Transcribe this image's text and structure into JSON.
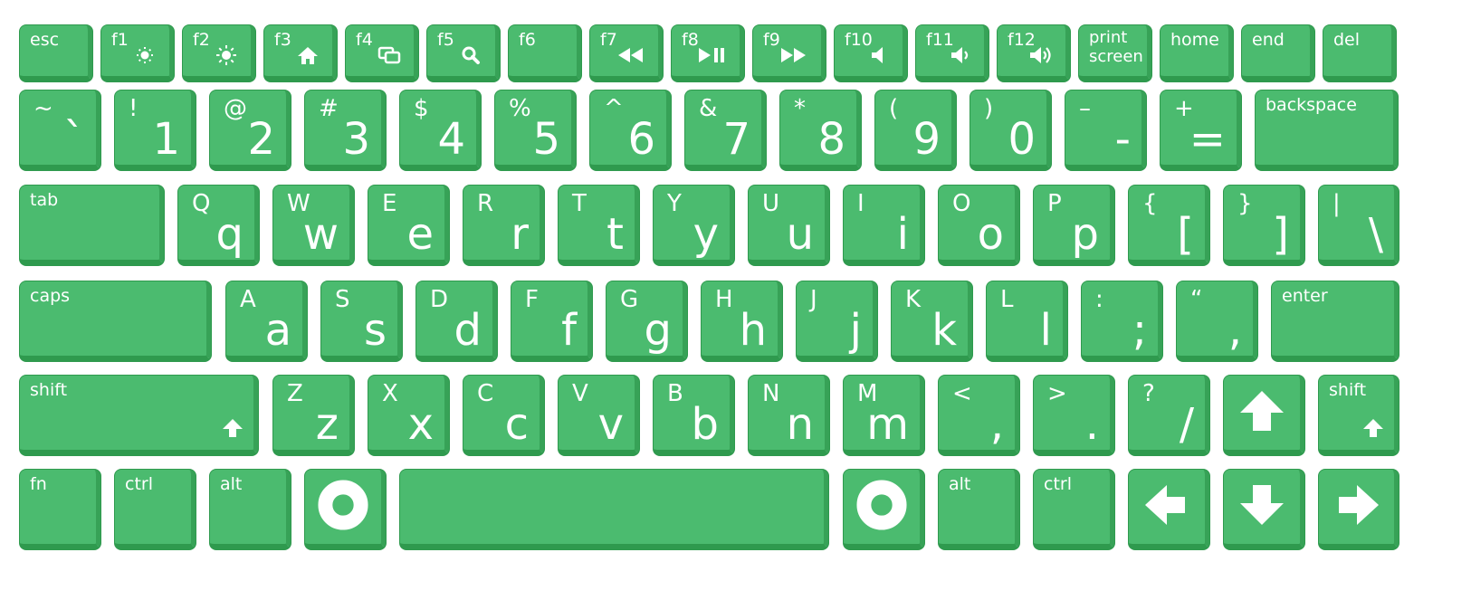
{
  "colors": {
    "key": "#4bbb6f",
    "key_edge": "#2f9a4e",
    "legend": "#ffffff",
    "background": "#ffffff"
  },
  "rows": [
    [
      {
        "id": "esc",
        "label": "esc"
      },
      {
        "id": "f1",
        "label": "f1",
        "icon": "brightness-down-icon"
      },
      {
        "id": "f2",
        "label": "f2",
        "icon": "brightness-up-icon"
      },
      {
        "id": "f3",
        "label": "f3",
        "icon": "home-icon"
      },
      {
        "id": "f4",
        "label": "f4",
        "icon": "window-switch-icon"
      },
      {
        "id": "f5",
        "label": "f5",
        "icon": "search-icon"
      },
      {
        "id": "f6",
        "label": "f6"
      },
      {
        "id": "f7",
        "label": "f7",
        "icon": "rewind-icon"
      },
      {
        "id": "f8",
        "label": "f8",
        "icon": "play-pause-icon"
      },
      {
        "id": "f9",
        "label": "f9",
        "icon": "fast-forward-icon"
      },
      {
        "id": "f10",
        "label": "f10",
        "icon": "mute-icon"
      },
      {
        "id": "f11",
        "label": "f11",
        "icon": "volume-down-icon"
      },
      {
        "id": "f12",
        "label": "f12",
        "icon": "volume-up-icon"
      },
      {
        "id": "print-screen",
        "label": "print\nscreen"
      },
      {
        "id": "home",
        "label": "home"
      },
      {
        "id": "end",
        "label": "end"
      },
      {
        "id": "del",
        "label": "del"
      }
    ],
    [
      {
        "id": "backtick",
        "top": "~",
        "main": "`"
      },
      {
        "id": "1",
        "top": "!",
        "main": "1"
      },
      {
        "id": "2",
        "top": "@",
        "main": "2"
      },
      {
        "id": "3",
        "top": "#",
        "main": "3"
      },
      {
        "id": "4",
        "top": "$",
        "main": "4"
      },
      {
        "id": "5",
        "top": "%",
        "main": "5"
      },
      {
        "id": "6",
        "top": "^",
        "main": "6"
      },
      {
        "id": "7",
        "top": "&",
        "main": "7"
      },
      {
        "id": "8",
        "top": "*",
        "main": "8"
      },
      {
        "id": "9",
        "top": "(",
        "main": "9"
      },
      {
        "id": "0",
        "top": ")",
        "main": "0"
      },
      {
        "id": "minus",
        "top": "–",
        "main": "-"
      },
      {
        "id": "equals",
        "top": "+",
        "main": "="
      },
      {
        "id": "backspace",
        "label": "backspace"
      }
    ],
    [
      {
        "id": "tab",
        "label": "tab"
      },
      {
        "id": "q",
        "top": "Q",
        "main": "q"
      },
      {
        "id": "w",
        "top": "W",
        "main": "w"
      },
      {
        "id": "e",
        "top": "E",
        "main": "e"
      },
      {
        "id": "r",
        "top": "R",
        "main": "r"
      },
      {
        "id": "t",
        "top": "T",
        "main": "t"
      },
      {
        "id": "y",
        "top": "Y",
        "main": "y"
      },
      {
        "id": "u",
        "top": "U",
        "main": "u"
      },
      {
        "id": "i",
        "top": "I",
        "main": "i"
      },
      {
        "id": "o",
        "top": "O",
        "main": "o"
      },
      {
        "id": "p",
        "top": "P",
        "main": "p"
      },
      {
        "id": "lbracket",
        "top": "{",
        "main": "["
      },
      {
        "id": "rbracket",
        "top": "}",
        "main": "]"
      },
      {
        "id": "backslash",
        "top": "|",
        "main": "\\"
      }
    ],
    [
      {
        "id": "caps",
        "label": "caps"
      },
      {
        "id": "a",
        "top": "A",
        "main": "a"
      },
      {
        "id": "s",
        "top": "S",
        "main": "s"
      },
      {
        "id": "d",
        "top": "D",
        "main": "d"
      },
      {
        "id": "f",
        "top": "F",
        "main": "f"
      },
      {
        "id": "g",
        "top": "G",
        "main": "g"
      },
      {
        "id": "h",
        "top": "H",
        "main": "h"
      },
      {
        "id": "j",
        "top": "J",
        "main": "j"
      },
      {
        "id": "k",
        "top": "K",
        "main": "k"
      },
      {
        "id": "l",
        "top": "L",
        "main": "l"
      },
      {
        "id": "semicolon",
        "top": ":",
        "main": ";"
      },
      {
        "id": "quote",
        "top": "“",
        "main": ","
      },
      {
        "id": "enter",
        "label": "enter"
      }
    ],
    [
      {
        "id": "shift-left",
        "label": "shift",
        "icon": "shift-arrow-icon"
      },
      {
        "id": "z",
        "top": "Z",
        "main": "z"
      },
      {
        "id": "x",
        "top": "X",
        "main": "x"
      },
      {
        "id": "c",
        "top": "C",
        "main": "c"
      },
      {
        "id": "v",
        "top": "V",
        "main": "v"
      },
      {
        "id": "b",
        "top": "B",
        "main": "b"
      },
      {
        "id": "n",
        "top": "N",
        "main": "n"
      },
      {
        "id": "m",
        "top": "M",
        "main": "m"
      },
      {
        "id": "comma",
        "top": "<",
        "main": ","
      },
      {
        "id": "period",
        "top": ">",
        "main": "."
      },
      {
        "id": "slash",
        "top": "?",
        "main": "/"
      },
      {
        "id": "arrow-up",
        "icon": "arrow-up-icon"
      },
      {
        "id": "shift-right",
        "label": "shift",
        "icon": "shift-arrow-icon"
      }
    ],
    [
      {
        "id": "fn",
        "label": "fn"
      },
      {
        "id": "ctrl-left",
        "label": "ctrl"
      },
      {
        "id": "alt-left",
        "label": "alt"
      },
      {
        "id": "meta-left",
        "icon": "ring-icon"
      },
      {
        "id": "space"
      },
      {
        "id": "meta-right",
        "icon": "ring-icon"
      },
      {
        "id": "alt-right",
        "label": "alt"
      },
      {
        "id": "ctrl-right",
        "label": "ctrl"
      },
      {
        "id": "arrow-left",
        "icon": "arrow-left-icon"
      },
      {
        "id": "arrow-down",
        "icon": "arrow-down-icon"
      },
      {
        "id": "arrow-right",
        "icon": "arrow-right-icon"
      }
    ]
  ]
}
